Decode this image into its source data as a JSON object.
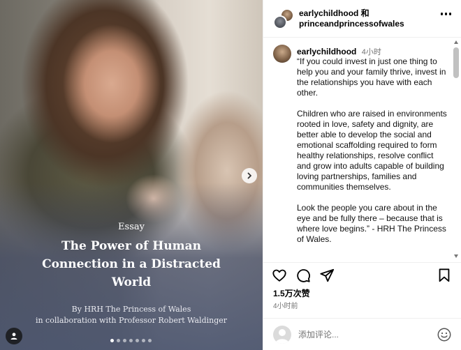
{
  "media": {
    "essay_kicker": "Essay",
    "essay_title": "The Power of Human Connection in a Distracted World",
    "byline_1": "By HRH The Princess of Wales",
    "byline_2": "in collaboration with Professor Robert Waldinger",
    "slide_count": 7,
    "active_slide": 1
  },
  "header": {
    "account_1": "earlychildhood 和",
    "account_2": "princeandprincessofwales"
  },
  "caption": {
    "username": "earlychildhood",
    "time": "4小时",
    "text": "“If you could invest in just one thing to help you and your family thrive, invest in the relationships you have with each other.\n\nChildren who are raised in environments rooted in love, safety and dignity, are better able to develop the social and emotional scaffolding required to form healthy relationships, resolve conflict and grow into adults capable of building loving partnerships, families and communities themselves.\n\nLook the people you care about in the eye and be fully there – because that is where love begins.” - HRH The Princess of Wales."
  },
  "actions": {
    "likes": "1.5万次赞",
    "post_time": "4小时前"
  },
  "comment_box": {
    "placeholder": "添加评论..."
  },
  "icons": {
    "like": "heart-icon",
    "comment": "comment-icon",
    "share": "share-icon",
    "save": "bookmark-icon",
    "emoji": "emoji-icon",
    "next": "chevron-right-icon",
    "tag": "user-tag-icon",
    "more": "more-icon"
  }
}
